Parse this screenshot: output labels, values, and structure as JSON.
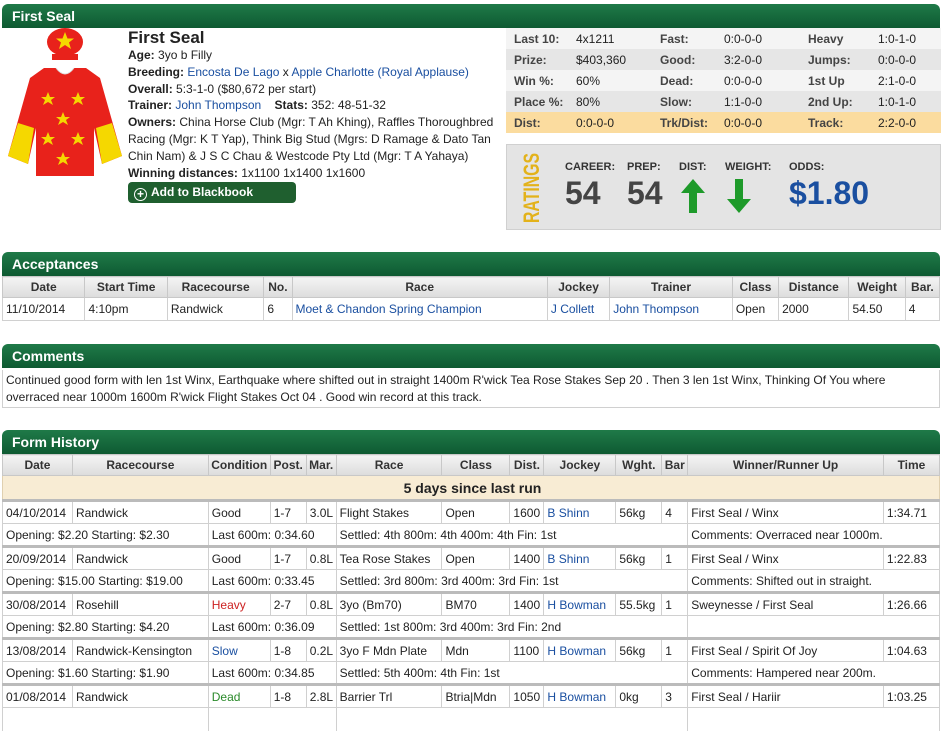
{
  "header": {
    "title": "First Seal"
  },
  "profile": {
    "name": "First Seal",
    "age_label": "Age:",
    "age": "3yo b Filly",
    "breeding_label": "Breeding:",
    "sire": "Encosta De Lago",
    "x": " x ",
    "dam": "Apple Charlotte",
    "damsire": "(Royal Applause)",
    "overall_label": "Overall:",
    "overall": "5:3-1-0 ($80,672 per start)",
    "trainer_label": "Trainer:",
    "trainer": "John Thompson",
    "stats_label": "Stats:",
    "stats": "352: 48-51-32",
    "owners_label": "Owners:",
    "owners": "China Horse Club (Mgr: T Ah Khing), Raffles Thoroughbred Racing (Mgr: K T Yap), Think Big Stud (Mgrs: D Ramage & Dato Tan Chin Nam) & J S C Chau & Westcode Pty Ltd (Mgr: T A Yahaya)",
    "distances_label": "Winning distances:",
    "distances": "1x1100 1x1400 1x1600",
    "blackbook": "Add to Blackbook",
    "silk_colors": {
      "body": "#e8221b",
      "stars": "#f5d800",
      "sleeves_lower": "#f5d800"
    }
  },
  "stats": [
    [
      "Last 10:",
      "4x1211",
      "Fast:",
      "0:0-0-0",
      "Heavy",
      "1:0-1-0"
    ],
    [
      "Prize:",
      "$403,360",
      "Good:",
      "3:2-0-0",
      "Jumps:",
      "0:0-0-0"
    ],
    [
      "Win %:",
      "60%",
      "Dead:",
      "0:0-0-0",
      "1st Up",
      "2:1-0-0"
    ],
    [
      "Place %:",
      "80%",
      "Slow:",
      "1:1-0-0",
      "2nd Up:",
      "1:0-1-0"
    ],
    [
      "Dist:",
      "0:0-0-0",
      "Trk/Dist:",
      "0:0-0-0",
      "Track:",
      "2:2-0-0"
    ]
  ],
  "ratings": {
    "word": "RATINGS",
    "career_label": "CAREER:",
    "career": "54",
    "prep_label": "PREP:",
    "prep": "54",
    "dist_label": "DIST:",
    "dist_dir": "up",
    "weight_label": "WEIGHT:",
    "weight_dir": "down",
    "odds_label": "ODDS:",
    "odds": "$1.80"
  },
  "acceptances": {
    "title": "Acceptances",
    "columns": [
      "Date",
      "Start Time",
      "Racecourse",
      "No.",
      "Race",
      "Jockey",
      "Trainer",
      "Class",
      "Distance",
      "Weight",
      "Bar."
    ],
    "row": [
      "11/10/2014",
      "4:10pm",
      "Randwick",
      "6",
      "Moet & Chandon Spring Champion",
      "J Collett",
      "John Thompson",
      "Open",
      "2000",
      "54.50",
      "4"
    ]
  },
  "comments": {
    "title": "Comments",
    "text": "Continued good form with len 1st Winx, Earthquake where shifted out in straight 1400m R'wick Tea Rose Stakes Sep 20 . Then 3 len 1st Winx, Thinking Of You where overraced near 1000m 1600m R'wick Flight Stakes Oct 04 . Good win record at this track."
  },
  "form": {
    "title": "Form History",
    "columns": [
      "Date",
      "Racecourse",
      "Condition",
      "Post.",
      "Mar.",
      "Race",
      "Class",
      "Dist.",
      "Jockey",
      "Wght.",
      "Bar",
      "Winner/Runner Up",
      "Time"
    ],
    "days_since": "5 days since last run",
    "runs": [
      {
        "date": "04/10/2014",
        "course": "Randwick",
        "cond": "Good",
        "post": "1-7",
        "mar": "3.0L",
        "race": "Flight Stakes",
        "class": "Open",
        "dist": "1600",
        "jockey": "B Shinn",
        "wght": "56kg",
        "bar": "4",
        "winner": "First Seal / Winx",
        "time": "1:34.71",
        "prices": "Opening: $2.20  Starting: $2.30",
        "last600": "Last 600m: 0:34.60",
        "settled": "Settled: 4th 800m: 4th 400m: 4th Fin: 1st",
        "comment": "Comments: Overraced near 1000m."
      },
      {
        "date": "20/09/2014",
        "course": "Randwick",
        "cond": "Good",
        "post": "1-7",
        "mar": "0.8L",
        "race": "Tea Rose Stakes",
        "class": "Open",
        "dist": "1400",
        "jockey": "B Shinn",
        "wght": "56kg",
        "bar": "1",
        "winner": "First Seal / Winx",
        "time": "1:22.83",
        "prices": "Opening: $15.00  Starting: $19.00",
        "last600": "Last 600m: 0:33.45",
        "settled": "Settled: 3rd 800m: 3rd 400m: 3rd Fin: 1st",
        "comment": "Comments: Shifted out in straight."
      },
      {
        "date": "30/08/2014",
        "course": "Rosehill",
        "cond": "Heavy",
        "post": "2-7",
        "mar": "0.8L",
        "race": "3yo (Bm70)",
        "class": "BM70",
        "dist": "1400",
        "jockey": "H Bowman",
        "wght": "55.5kg",
        "bar": "1",
        "winner": "Sweynesse / First Seal",
        "time": "1:26.66",
        "prices": "Opening: $2.80  Starting: $4.20",
        "last600": "Last 600m: 0:36.09",
        "settled": "Settled: 1st 800m: 3rd 400m: 3rd Fin: 2nd",
        "comment": ""
      },
      {
        "date": "13/08/2014",
        "course": "Randwick-Kensington",
        "cond": "Slow",
        "post": "1-8",
        "mar": "0.2L",
        "race": "3yo F Mdn Plate",
        "class": "Mdn",
        "dist": "1100",
        "jockey": "H Bowman",
        "wght": "56kg",
        "bar": "1",
        "winner": "First Seal / Spirit Of Joy",
        "time": "1:04.63",
        "prices": "Opening: $1.60  Starting: $1.90",
        "last600": "Last 600m: 0:34.85",
        "settled": "Settled: 5th 400m: 4th Fin: 1st",
        "comment": "Comments: Hampered near 200m."
      },
      {
        "date": "01/08/2014",
        "course": "Randwick",
        "cond": "Dead",
        "post": "1-8",
        "mar": "2.8L",
        "race": "Barrier Trl",
        "class": "Btria|Mdn",
        "dist": "1050",
        "jockey": "H Bowman",
        "wght": "0kg",
        "bar": "3",
        "winner": "First Seal / Hariir",
        "time": "1:03.25",
        "prices": "",
        "last600": "",
        "settled": "",
        "comment": ""
      }
    ]
  }
}
